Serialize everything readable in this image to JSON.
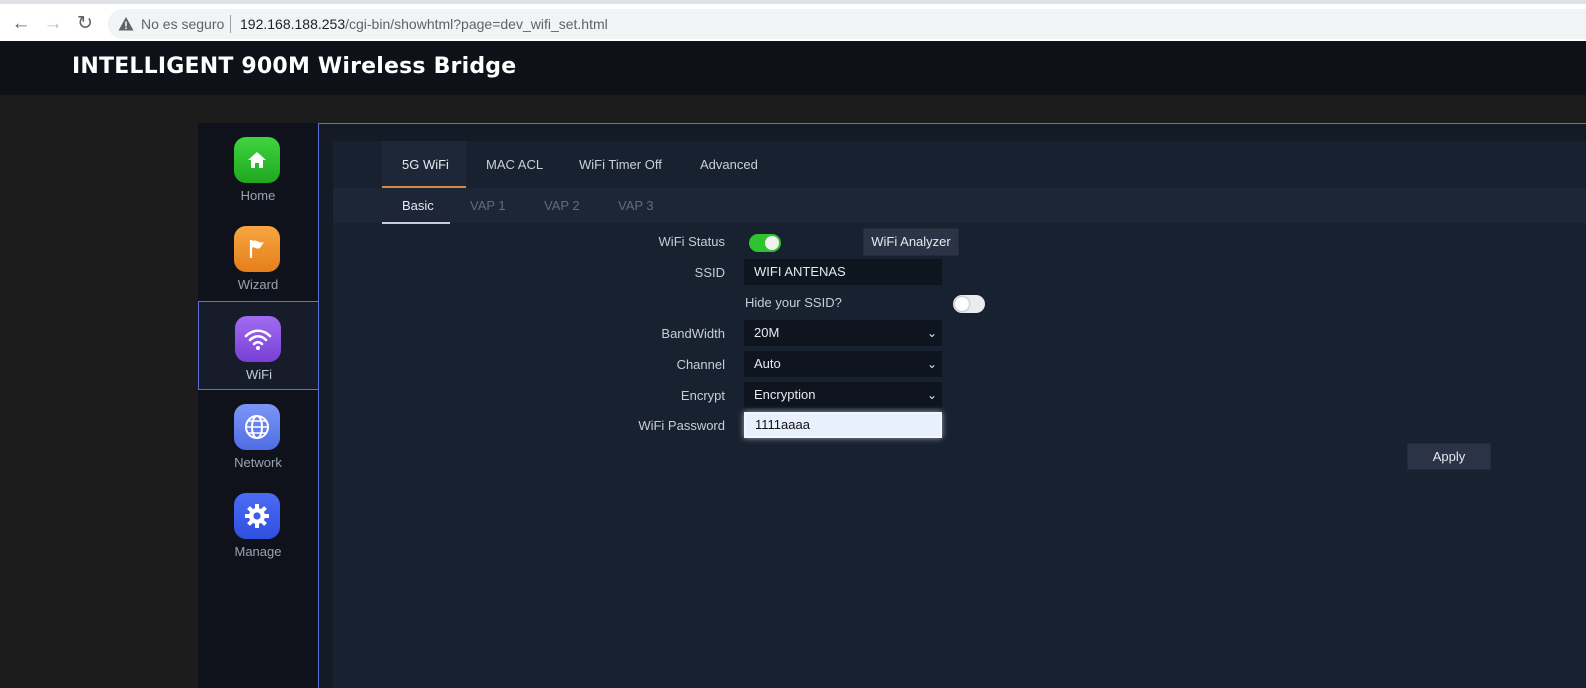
{
  "browser": {
    "security_label": "No es seguro",
    "url_host": "192.168.188.253",
    "url_path": "/cgi-bin/showhtml?page=dev_wifi_set.html"
  },
  "header": {
    "title": "INTELLIGENT 900M Wireless Bridge"
  },
  "sidebar": {
    "items": [
      {
        "label": "Home",
        "icon": "home-icon",
        "color": "#28b728"
      },
      {
        "label": "Wizard",
        "icon": "flag-icon",
        "color": "#f0902a"
      },
      {
        "label": "WiFi",
        "icon": "wifi-icon",
        "color": "#8b52e0"
      },
      {
        "label": "Network",
        "icon": "globe-icon",
        "color": "#5f7ef0"
      },
      {
        "label": "Manage",
        "icon": "gear-icon",
        "color": "#3b5cf0"
      }
    ],
    "active": "WiFi"
  },
  "tabs": [
    "5G WiFi",
    "MAC ACL",
    "WiFi Timer Off",
    "Advanced"
  ],
  "subtabs": [
    "Basic",
    "VAP 1",
    "VAP 2",
    "VAP 3"
  ],
  "form": {
    "wifi_status_label": "WiFi Status",
    "wifi_status": "on",
    "analyzer_button": "WiFi Analyzer",
    "ssid_label": "SSID",
    "ssid_value": "WIFI ANTENAS",
    "hide_ssid_label": "Hide your SSID?",
    "hide_ssid": "off",
    "bandwidth_label": "BandWidth",
    "bandwidth_value": "20M",
    "channel_label": "Channel",
    "channel_value": "Auto",
    "encrypt_label": "Encrypt",
    "encrypt_value": "Encryption",
    "password_label": "WiFi Password",
    "password_value": "1111aaaa",
    "apply_button": "Apply"
  },
  "colors": {
    "accent_tab": "#d98a43",
    "frame_border": "#5a6fd8",
    "toggle_on": "#2fc32f"
  }
}
